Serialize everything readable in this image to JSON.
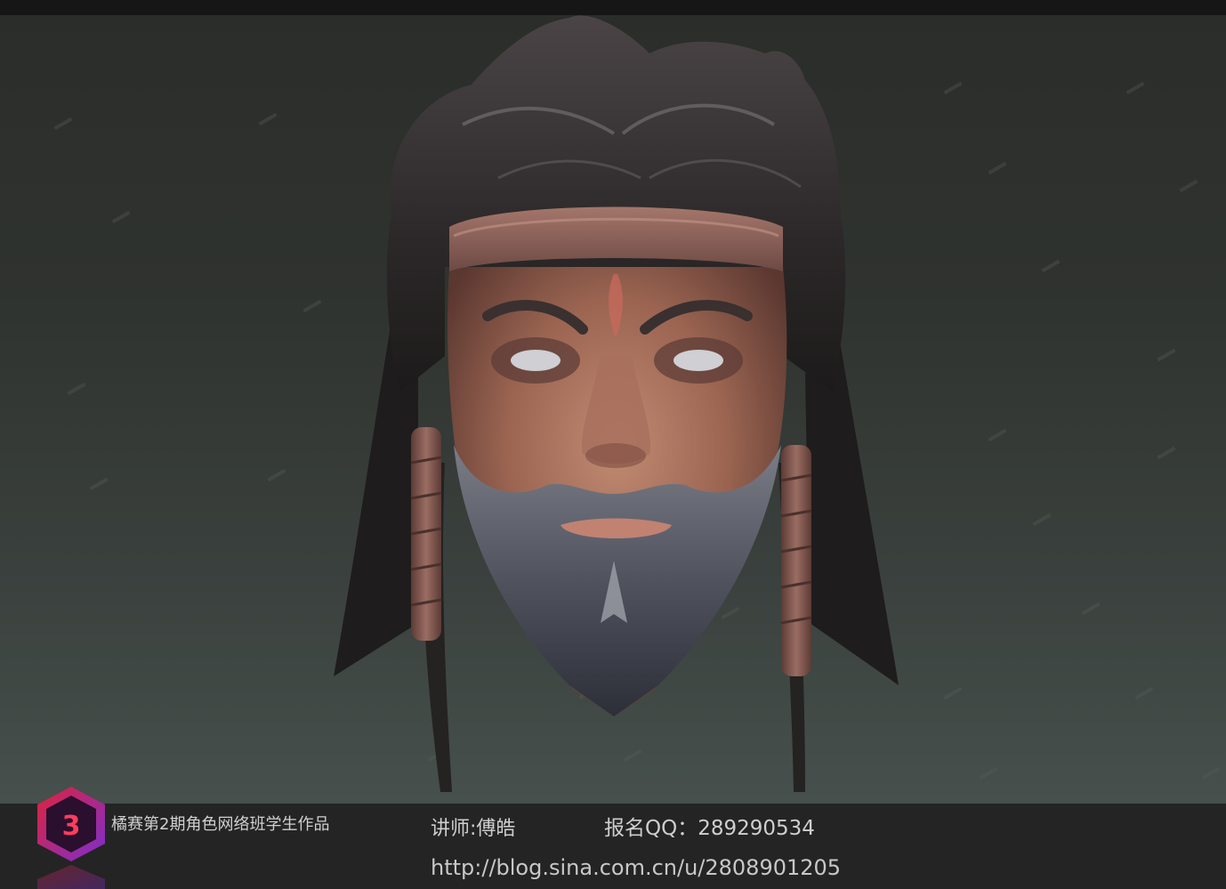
{
  "footer": {
    "course_caption": "橘赛第2期角色网络班学生作品",
    "teacher_caption": "讲师:傅皓",
    "signup_caption": "报名QQ：289290534",
    "blog_url": "http://blog.sina.com.cn/u/2808901205"
  },
  "logo": {
    "icon": "hexagon-3d-logo-icon",
    "primary_color": "#e0233a",
    "secondary_color": "#7b2ed0"
  },
  "render": {
    "subject": "character-head-icon",
    "background_top_color": "#2b2d2a",
    "background_bottom_color": "#46504c"
  }
}
